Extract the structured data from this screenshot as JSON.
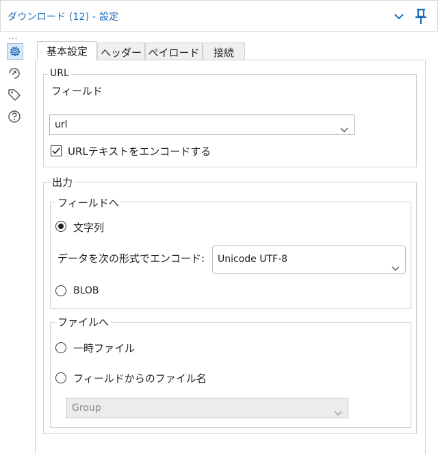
{
  "window": {
    "title": "ダウンロード (12) - 設定"
  },
  "sidebar": {
    "overflow_text": "...",
    "icons": [
      "gear-icon",
      "refresh-arrow-icon",
      "tag-icon",
      "help-icon"
    ]
  },
  "tabs": [
    {
      "label": "基本設定",
      "active": true
    },
    {
      "label": "ヘッダー",
      "active": false
    },
    {
      "label": "ペイロード",
      "active": false
    },
    {
      "label": "接続",
      "active": false
    }
  ],
  "url_group": {
    "legend": "URL",
    "field_label": "フィールド",
    "field_value": "url",
    "encode_checkbox_label": "URLテキストをエンコードする",
    "encode_checked": true
  },
  "output_group": {
    "legend": "出力",
    "to_field": {
      "legend": "フィールドへ",
      "string_label": "文字列",
      "string_selected": true,
      "encode_label": "データを次の形式でエンコード:",
      "encode_value": "Unicode UTF-8",
      "blob_label": "BLOB",
      "blob_selected": false
    },
    "to_file": {
      "legend": "ファイルへ",
      "temp_file_label": "一時ファイル",
      "temp_file_selected": false,
      "filename_from_field_label": "フィールドからのファイル名",
      "filename_from_field_selected": false,
      "filename_field_value": "Group"
    }
  },
  "colors": {
    "title": "#1d6fb8",
    "accent": "#1d6fb8",
    "border": "#d0d0d0"
  }
}
